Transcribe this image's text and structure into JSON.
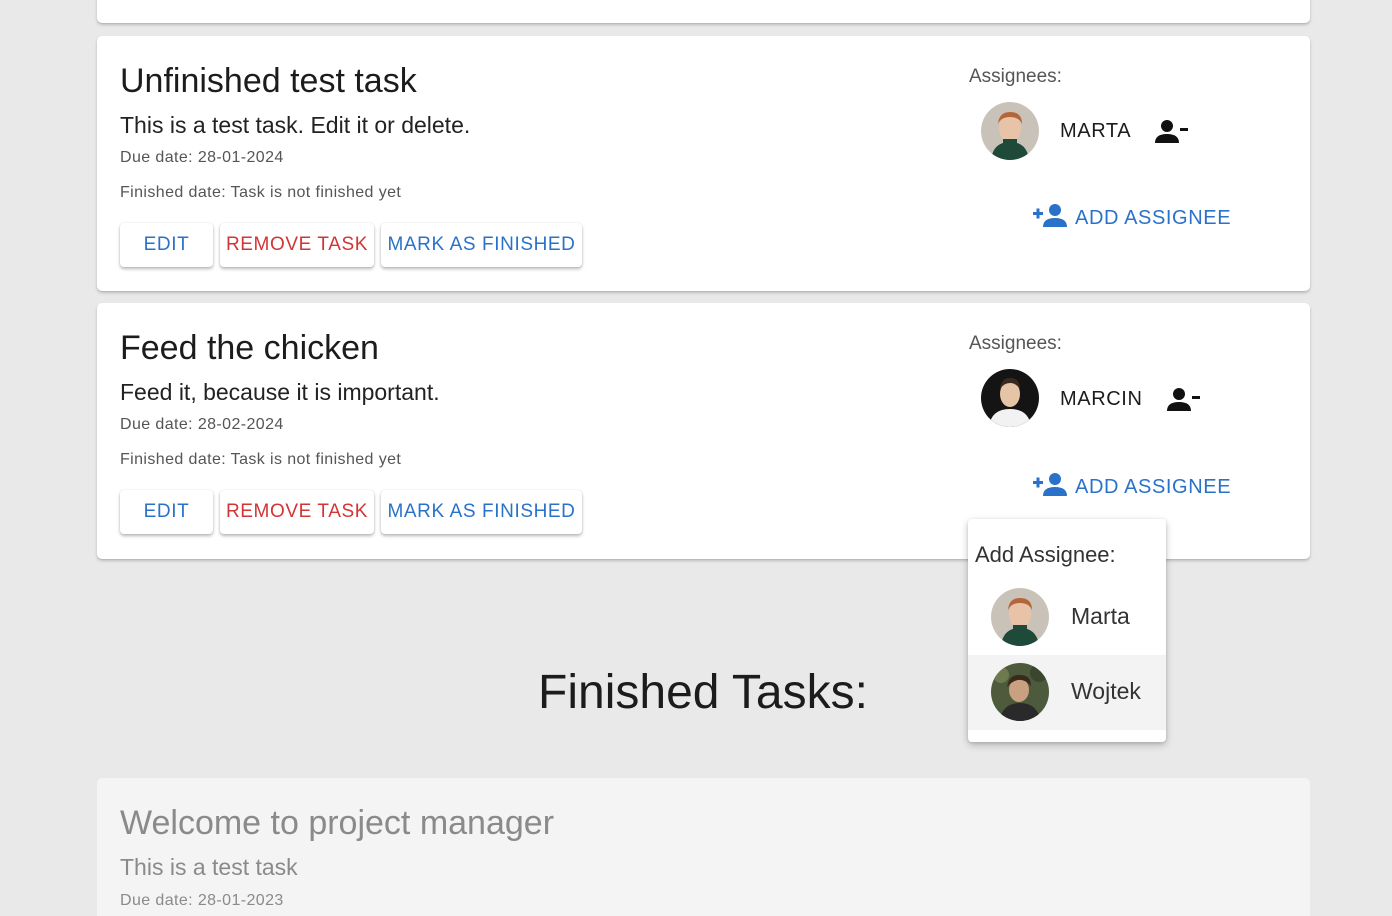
{
  "tasks": [
    {
      "title": "Unfinished test task",
      "description": "This is a test task. Edit it or delete.",
      "due_date": "Due date: 28-01-2024",
      "finished_date": "Finished date: Task is not finished yet",
      "buttons": {
        "edit": "EDIT",
        "remove": "REMOVE TASK",
        "finish": "MARK AS FINISHED"
      },
      "assignees_label": "Assignees:",
      "assignees": [
        {
          "name": "MARTA",
          "avatar": "marta-photo"
        }
      ],
      "add_assignee_label": "ADD ASSIGNEE"
    },
    {
      "title": "Feed the chicken",
      "description": "Feed it, because it is important.",
      "due_date": "Due date: 28-02-2024",
      "finished_date": "Finished date: Task is not finished yet",
      "buttons": {
        "edit": "EDIT",
        "remove": "REMOVE TASK",
        "finish": "MARK AS FINISHED"
      },
      "assignees_label": "Assignees:",
      "assignees": [
        {
          "name": "MARCIN",
          "avatar": "marcin-photo"
        }
      ],
      "add_assignee_label": "ADD ASSIGNEE"
    }
  ],
  "add_assignee_popup": {
    "title": "Add Assignee:",
    "options": [
      {
        "name": "Marta",
        "avatar": "marta-photo"
      },
      {
        "name": "Wojtek",
        "avatar": "wojtek-photo",
        "hovered": true
      }
    ]
  },
  "finished_section": {
    "heading": "Finished Tasks:",
    "tasks": [
      {
        "title": "Welcome to project manager",
        "description": "This is a test task",
        "due_date": "Due date: 28-01-2023"
      }
    ]
  },
  "colors": {
    "accent_blue": "#2a72c9",
    "danger_red": "#d23535",
    "page_bg": "#e9e9e9"
  },
  "icons": {
    "remove_assignee": "person-remove-icon",
    "add_assignee": "person-add-icon"
  }
}
